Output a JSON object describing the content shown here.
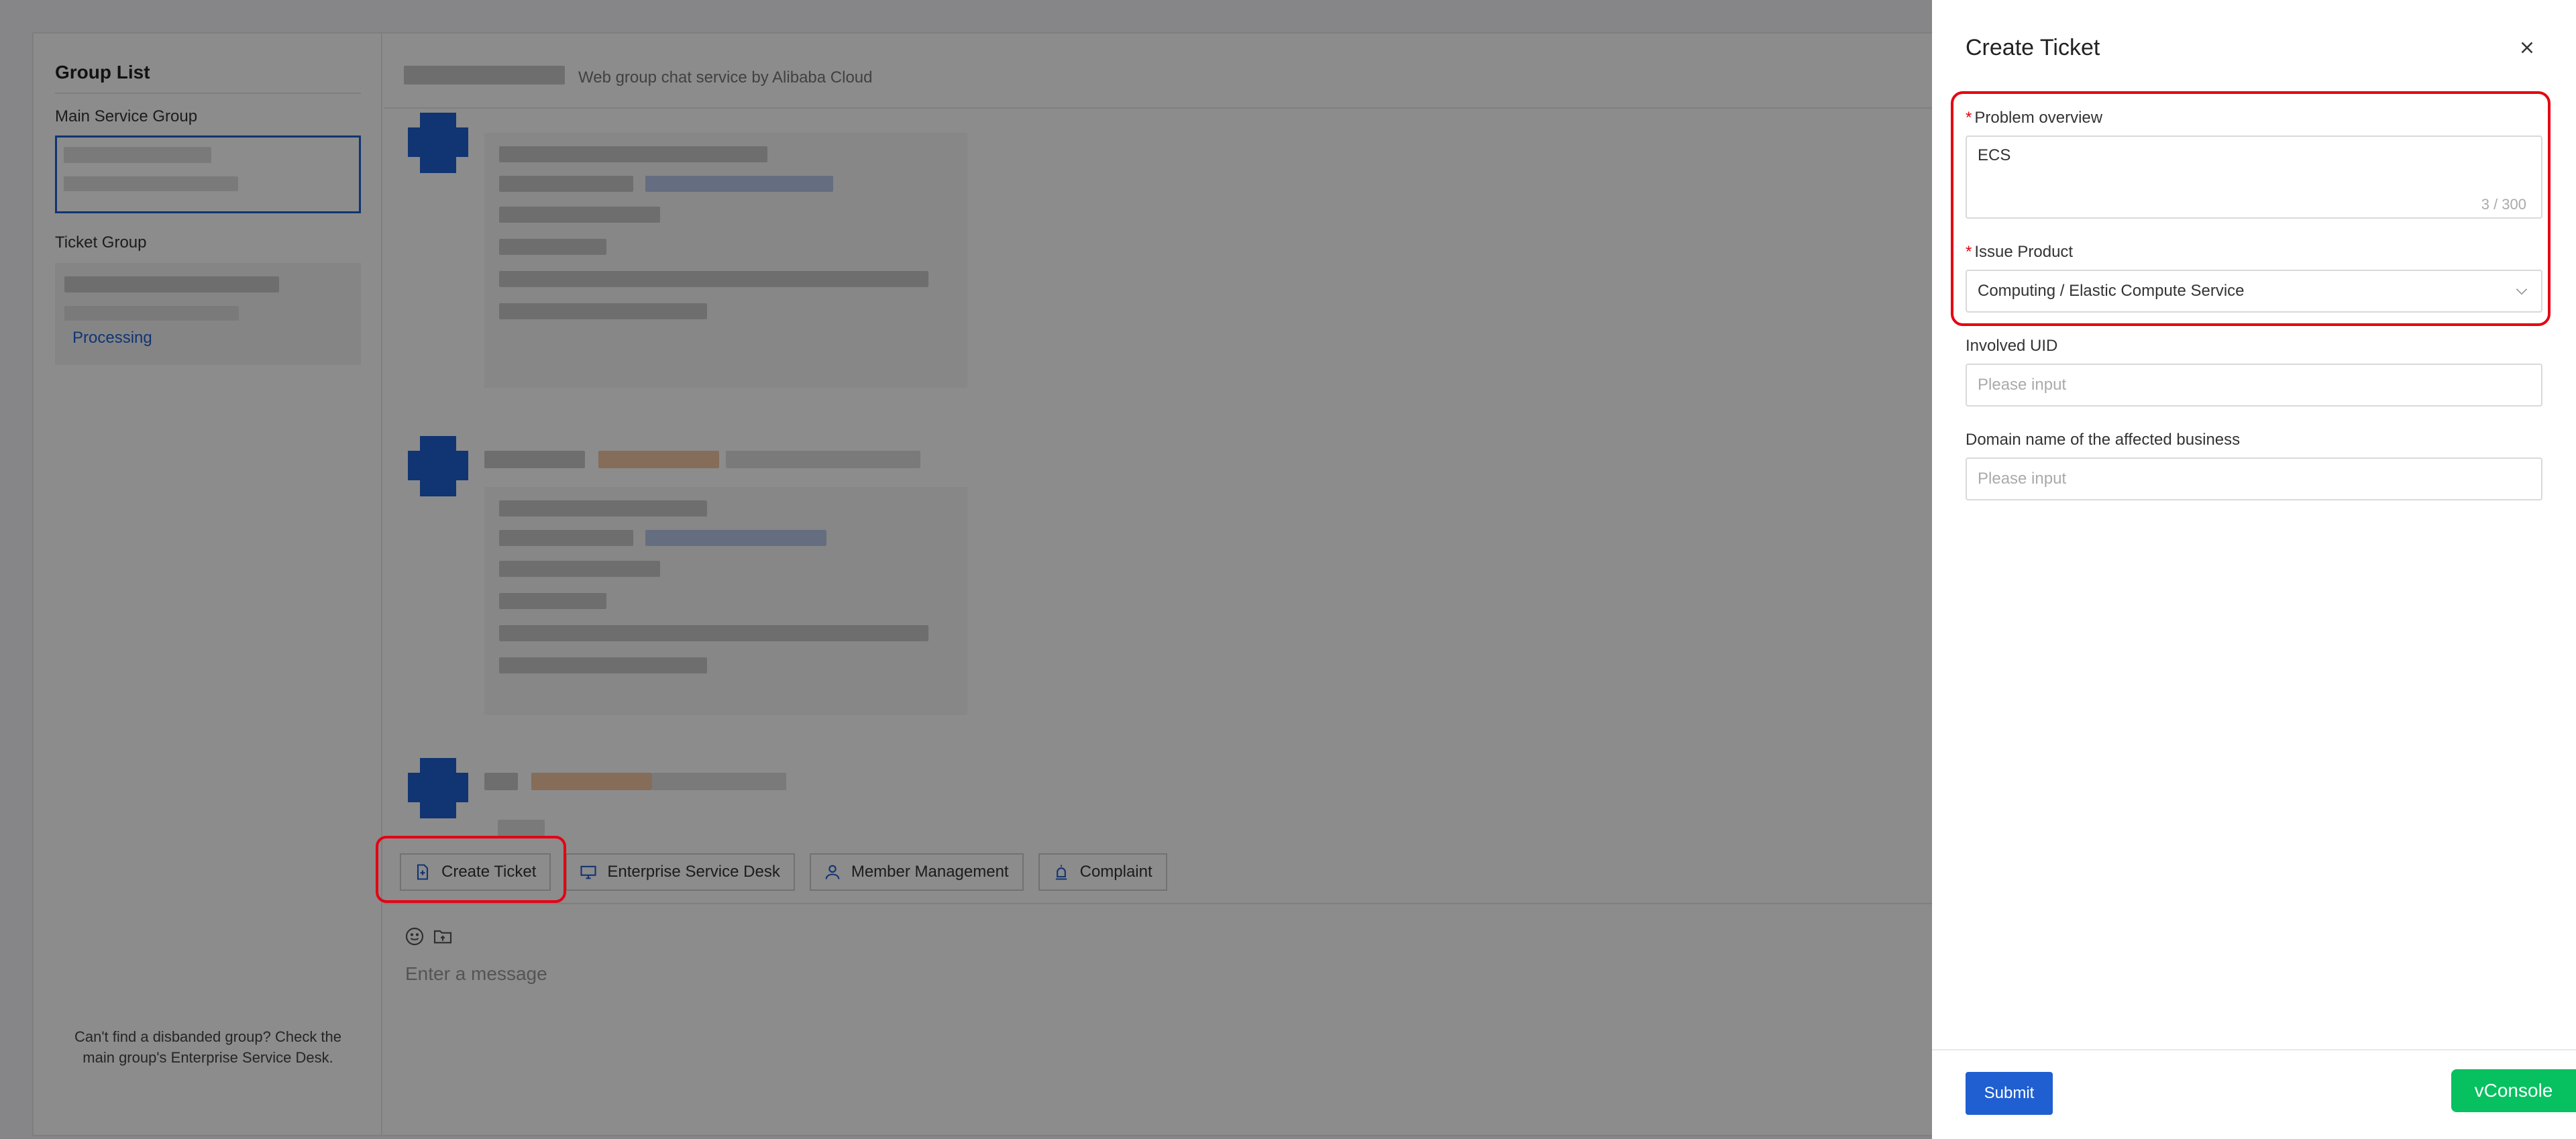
{
  "sidebar": {
    "title": "Group List",
    "main_service_group_label": "Main Service Group",
    "ticket_group_label": "Ticket Group",
    "processing_status": "Processing",
    "footer_text": "Can't find a disbanded group? Check the main group's Enterprise Service Desk."
  },
  "chat": {
    "subtitle": "Web group chat service by Alibaba Cloud",
    "toolbar": {
      "create_ticket": "Create Ticket",
      "enterprise_service_desk": "Enterprise Service Desk",
      "member_management": "Member Management",
      "complaint": "Complaint"
    },
    "input_placeholder": "Enter a message"
  },
  "drawer": {
    "title": "Create Ticket",
    "problem_overview": {
      "label": "Problem overview",
      "value": "ECS",
      "counter": "3 / 300"
    },
    "issue_product": {
      "label": "Issue Product",
      "value": "Computing / Elastic Compute Service"
    },
    "involved_uid": {
      "label": "Involved UID",
      "placeholder": "Please input"
    },
    "affected_domain": {
      "label": "Domain name of the affected business",
      "placeholder": "Please input"
    },
    "submit_label": "Submit"
  },
  "vconsole_label": "vConsole",
  "colors": {
    "accent": "#1f5fd1",
    "highlight": "#e60012",
    "vconsole": "#07c160"
  }
}
